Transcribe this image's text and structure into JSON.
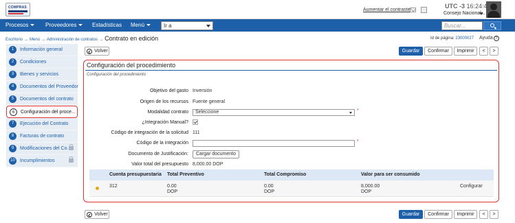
{
  "header": {
    "logo_text": "COMPRAS",
    "contrast_link": "Aumentar el contraste",
    "utc_zone": "UTC -3",
    "utc_time": "16:24:46",
    "user_name": "Consejo Nacional..."
  },
  "nav": {
    "items": [
      "Procesos",
      "Proveedores",
      "Estadísticas",
      "Menú"
    ],
    "goto_value": "Ir a",
    "search_placeholder": "Buscar..."
  },
  "breadcrumb": {
    "items": [
      "Escritorio",
      "Menú",
      "Administración de contratos"
    ],
    "current": "Contrato en edición"
  },
  "page_id": {
    "label": "Id de página:",
    "value": "23000027"
  },
  "help_label": "Ayuda",
  "help_symbol": "?",
  "sidebar": {
    "steps": [
      {
        "num": "1",
        "label": "Información general"
      },
      {
        "num": "2",
        "label": "Condiciones"
      },
      {
        "num": "3",
        "label": "Bienes y servicios"
      },
      {
        "num": "4",
        "label": "Documentos del Proveedor"
      },
      {
        "num": "5",
        "label": "Documentos del contrato"
      },
      {
        "num": "6",
        "label": "Configuración del proce..."
      },
      {
        "num": "7",
        "label": "Ejecución del Contrato"
      },
      {
        "num": "8",
        "label": "Facturas de contrato"
      },
      {
        "num": "9",
        "label": "Modificaciones del Co..."
      },
      {
        "num": "10",
        "label": "Incumplimientos"
      }
    ]
  },
  "actions": {
    "back": "Volver",
    "save": "Guardar",
    "confirm": "Confirmar",
    "print": "Imprimir",
    "prev": "<",
    "next": ">"
  },
  "panel": {
    "title": "Configuración del procedimiento",
    "subtitle": "Configuración del procedimiento",
    "fields": {
      "objetivo_label": "Objetivo del gasto",
      "objetivo_value": "Inversión",
      "origen_label": "Origen de los recursos",
      "origen_value": "Fuente general",
      "modalidad_label": "Modalidad contrato",
      "modalidad_value": "Seleccione",
      "integracion_label": "¿Integración Manual?",
      "codigo_solicitud_label": "Código de integración de la solicitud",
      "codigo_solicitud_value": "111",
      "codigo_integracion_label": "Código de la integración",
      "codigo_integracion_value": "",
      "documento_label": "Documento de Justificación:",
      "documento_button": "Cargar documento",
      "valor_label": "Valor total del presupuesto",
      "valor_value": "8,000.00 DOP",
      "required_mark": "*"
    },
    "table": {
      "headers": [
        "Cuenta presupuestaria",
        "Total Preventivo",
        "Total Compromiso",
        "Valor para ser consumido"
      ],
      "row": {
        "cuenta": "312",
        "preventivo_amount": "0.00",
        "preventivo_currency": "DOP",
        "compromiso_amount": "0.00",
        "compromiso_currency": "DOP",
        "valor_amount": "8,000.00",
        "valor_currency": "DOP",
        "action": "Configurar"
      }
    }
  }
}
